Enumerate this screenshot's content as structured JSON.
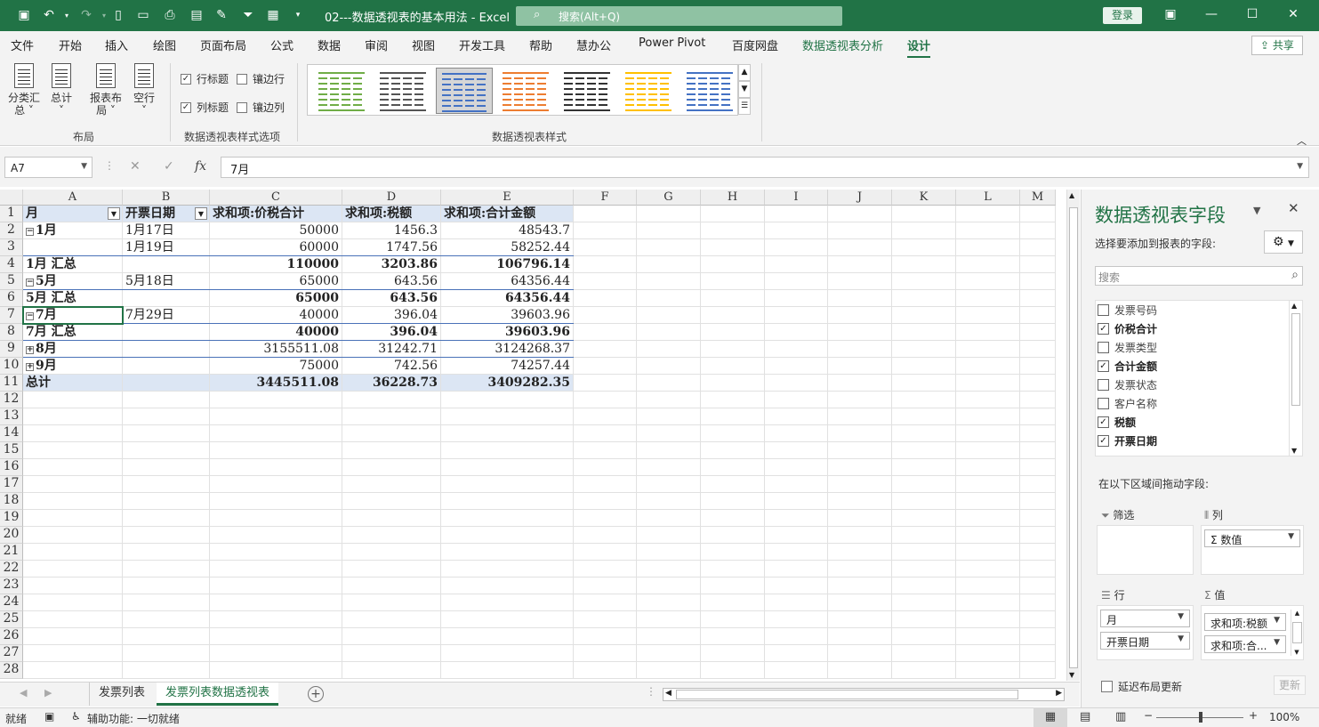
{
  "titlebar": {
    "doc_title": "02---数据透视表的基本用法  -  Excel",
    "search_placeholder": "搜索(Alt+Q)",
    "login": "登录"
  },
  "ribbon_tabs": [
    "文件",
    "开始",
    "插入",
    "绘图",
    "页面布局",
    "公式",
    "数据",
    "审阅",
    "视图",
    "开发工具",
    "帮助",
    "慧办公",
    "Power Pivot",
    "百度网盘",
    "数据透视表分析",
    "设计"
  ],
  "share_label": "共享",
  "ribbon": {
    "layout_buttons": [
      {
        "line1": "分类汇",
        "line2": "总 ˅"
      },
      {
        "line1": "总计",
        "line2": "˅"
      },
      {
        "line1": "报表布",
        "line2": "局 ˅"
      },
      {
        "line1": "空行",
        "line2": "˅"
      }
    ],
    "layout_group": "布局",
    "options": {
      "row_headers": "行标题",
      "col_headers": "列标题",
      "banded_rows": "镶边行",
      "banded_cols": "镶边列"
    },
    "options_group": "数据透视表样式选项",
    "styles_group": "数据透视表样式",
    "accent_colors": [
      "#70ad47",
      "#555555",
      "#4472c4",
      "#ed7d31",
      "#333333",
      "#ffc000",
      "#4472c4"
    ]
  },
  "formula_bar": {
    "name_box": "A7",
    "formula": "7月"
  },
  "columns": [
    "A",
    "B",
    "C",
    "D",
    "E",
    "F",
    "G",
    "H",
    "I",
    "J",
    "K",
    "L",
    "M"
  ],
  "rows": [
    "1",
    "2",
    "3",
    "4",
    "5",
    "6",
    "7",
    "8",
    "9",
    "10",
    "11",
    "12",
    "13",
    "14",
    "15",
    "16",
    "17",
    "18",
    "19",
    "20",
    "21",
    "22",
    "23",
    "24",
    "25",
    "26",
    "27",
    "28"
  ],
  "pivot": {
    "headers": [
      "月",
      "开票日期",
      "求和项:价税合计",
      "求和项:税额",
      "求和项:合计金额"
    ],
    "data": [
      [
        "1月",
        "1月17日",
        "50000",
        "1456.3",
        "48543.7"
      ],
      [
        "",
        "1月19日",
        "60000",
        "1747.56",
        "58252.44"
      ],
      [
        "1月 汇总",
        "",
        "110000",
        "3203.86",
        "106796.14"
      ],
      [
        "5月",
        "5月18日",
        "65000",
        "643.56",
        "64356.44"
      ],
      [
        "5月 汇总",
        "",
        "65000",
        "643.56",
        "64356.44"
      ],
      [
        "7月",
        "7月29日",
        "40000",
        "396.04",
        "39603.96"
      ],
      [
        "7月 汇总",
        "",
        "40000",
        "396.04",
        "39603.96"
      ],
      [
        "8月",
        "",
        "3155511.08",
        "31242.71",
        "3124268.37"
      ],
      [
        "9月",
        "",
        "75000",
        "742.56",
        "74257.44"
      ],
      [
        "总计",
        "",
        "3445511.08",
        "36228.73",
        "3409282.35"
      ]
    ]
  },
  "sheet_tabs": [
    "发票列表",
    "发票列表数据透视表"
  ],
  "status": {
    "ready": "就绪",
    "accessibility": "辅助功能: 一切就绪",
    "zoom": "100%"
  },
  "pane": {
    "title": "数据透视表字段",
    "subtitle": "选择要添加到报表的字段:",
    "search_placeholder": "搜索",
    "fields": [
      {
        "name": "发票号码",
        "checked": false
      },
      {
        "name": "价税合计",
        "checked": true
      },
      {
        "name": "发票类型",
        "checked": false
      },
      {
        "name": "合计金额",
        "checked": true
      },
      {
        "name": "发票状态",
        "checked": false
      },
      {
        "name": "客户名称",
        "checked": false
      },
      {
        "name": "税额",
        "checked": true
      },
      {
        "name": "开票日期",
        "checked": true
      }
    ],
    "drag_hint": "在以下区域间拖动字段:",
    "filter_label": "筛选",
    "columns_label": "列",
    "rows_label": "行",
    "values_label": "值",
    "column_items": [
      "Σ 数值"
    ],
    "row_items": [
      "月",
      "开票日期"
    ],
    "value_items": [
      "求和项:税额",
      "求和项:合..."
    ],
    "defer_label": "延迟布局更新",
    "update_label": "更新"
  }
}
